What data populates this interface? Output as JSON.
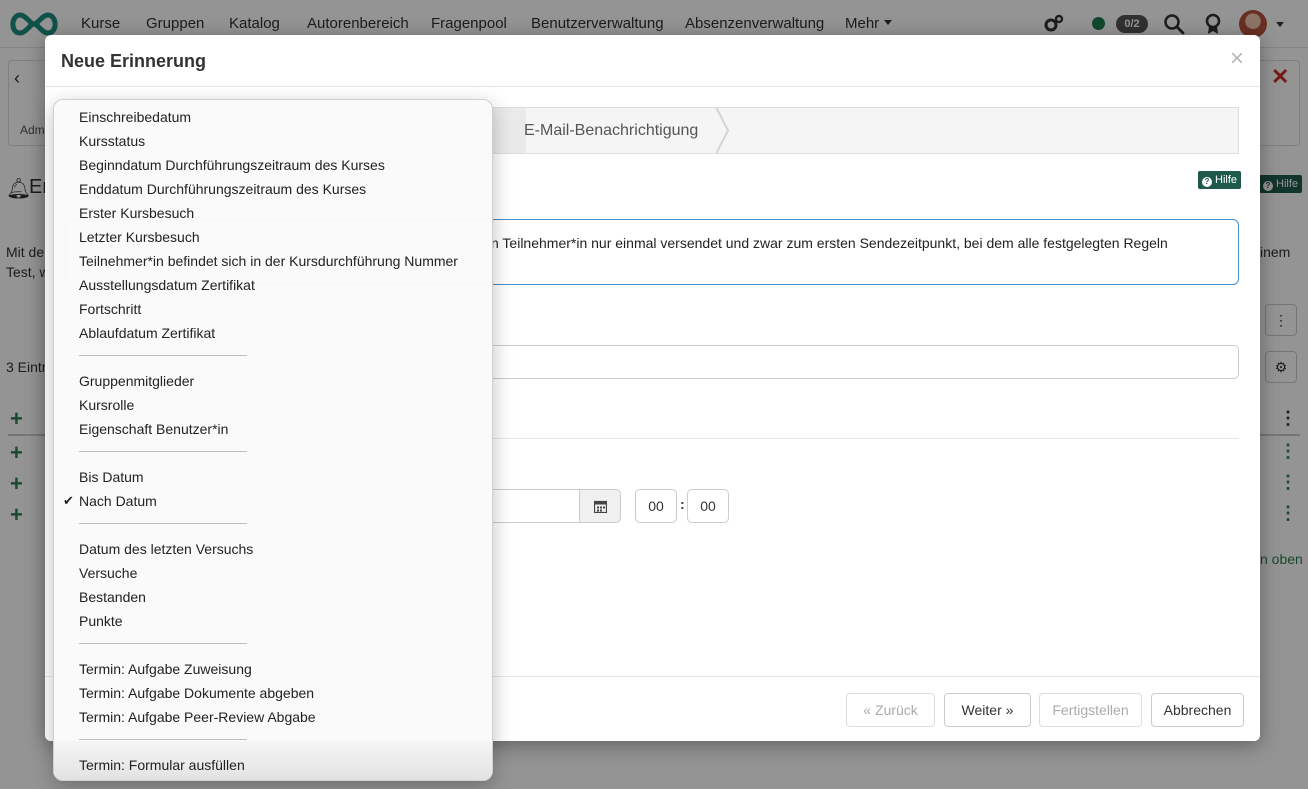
{
  "topnav": {
    "items": [
      "Kurse",
      "Gruppen",
      "Katalog",
      "Autorenbereich",
      "Fragenpool",
      "Benutzerverwaltung",
      "Absenzenverwaltung",
      "Mehr"
    ],
    "counter": "0/2",
    "icons": [
      "gears-icon",
      "search-icon",
      "award-icon"
    ],
    "status_color": "#1e7d4f"
  },
  "background": {
    "partial_title": "Er",
    "partial_crumb": "Adm",
    "partial_text1": "Mit de",
    "partial_text2": "Test, w",
    "partial_entries": "3 Eintr",
    "partial_right1": "inem",
    "partial_right2": "n oben",
    "help_label": "Hilfe"
  },
  "modal": {
    "title": "Neue Erinnerung",
    "close": "×",
    "wizard_step3": "E-Mail-Benachrichtigung",
    "help_label": "Hilfe",
    "info_text": "n Teilnehmer*in nur einmal versendet und zwar zum ersten Sendezeitpunkt, bei dem alle festgelegten Regeln",
    "time_hours": "00",
    "time_minutes": "00",
    "footer": {
      "back": "Zurück",
      "next": "Weiter",
      "finish": "Fertigstellen",
      "cancel": "Abbrechen"
    }
  },
  "dropdown": {
    "selected": "Nach Datum",
    "groups": [
      [
        "Einschreibedatum",
        "Kursstatus",
        "Beginndatum Durchführungszeitraum des Kurses",
        "Enddatum Durchführungszeitraum des Kurses",
        "Erster Kursbesuch",
        "Letzter Kursbesuch",
        "Teilnehmer*in befindet sich in der Kursdurchführung Nummer",
        "Ausstellungsdatum Zertifikat",
        "Fortschritt",
        "Ablaufdatum Zertifikat"
      ],
      [
        "Gruppenmitglieder",
        "Kursrolle",
        "Eigenschaft Benutzer*in"
      ],
      [
        "Bis Datum",
        "Nach Datum"
      ],
      [
        "Datum des letzten Versuchs",
        "Versuche",
        "Bestanden",
        "Punkte"
      ],
      [
        "Termin: Aufgabe Zuweisung",
        "Termin: Aufgabe Dokumente abgeben",
        "Termin: Aufgabe Peer-Review Abgabe"
      ],
      [
        "Termin: Formular ausfüllen"
      ]
    ]
  }
}
